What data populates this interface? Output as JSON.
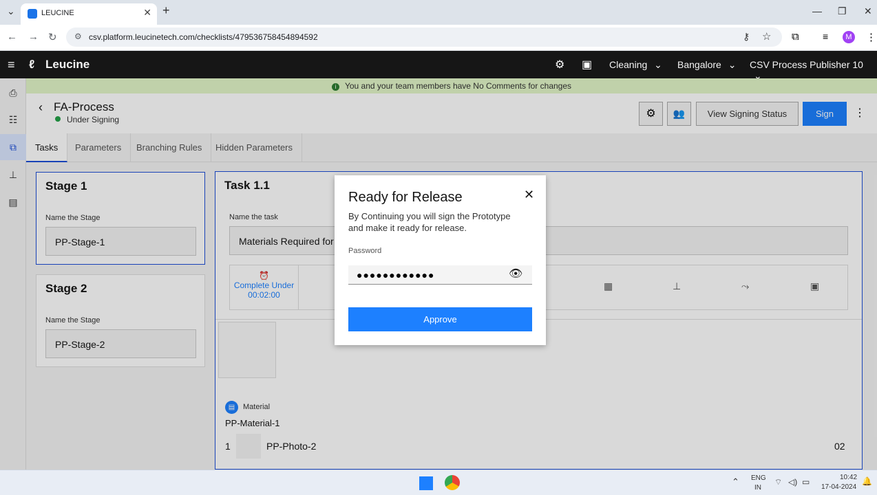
{
  "browser": {
    "tab_title": "LEUCINE",
    "url": "csv.platform.leucinetech.com/checklists/479536758454894592",
    "profile_initial": "M"
  },
  "app": {
    "brand": "Leucine",
    "facility": "Cleaning",
    "location": "Bangalore",
    "user": "CSV Process Publisher 10"
  },
  "banner": {
    "text": "You and your team members have No Comments for changes"
  },
  "page": {
    "title": "FA-Process",
    "status": "Under Signing",
    "view_signing_status": "View Signing Status",
    "sign": "Sign"
  },
  "tabs": [
    "Tasks",
    "Parameters",
    "Branching Rules",
    "Hidden Parameters"
  ],
  "stages": [
    {
      "title": "Stage 1",
      "label": "Name the Stage",
      "value": "PP-Stage-1"
    },
    {
      "title": "Stage 2",
      "label": "Name the Stage",
      "value": "PP-Stage-2"
    }
  ],
  "task": {
    "title": "Task 1.1",
    "name_label": "Name the task",
    "name_value": "Materials Required for C",
    "timer_line1": "Complete Under",
    "timer_line2": "00:02:00",
    "material_label": "Material",
    "material_name": "PP-Material-1",
    "item_index": "1",
    "item_name": "PP-Photo-2",
    "item_qty": "02"
  },
  "modal": {
    "title": "Ready for Release",
    "description": "By Continuing you will sign the Prototype and make it ready for release.",
    "password_label": "Password",
    "password_value": "●●●●●●●●●●●●",
    "approve": "Approve"
  },
  "taskbar": {
    "lang1": "ENG",
    "lang2": "IN",
    "time": "10:42",
    "date": "17-04-2024"
  }
}
